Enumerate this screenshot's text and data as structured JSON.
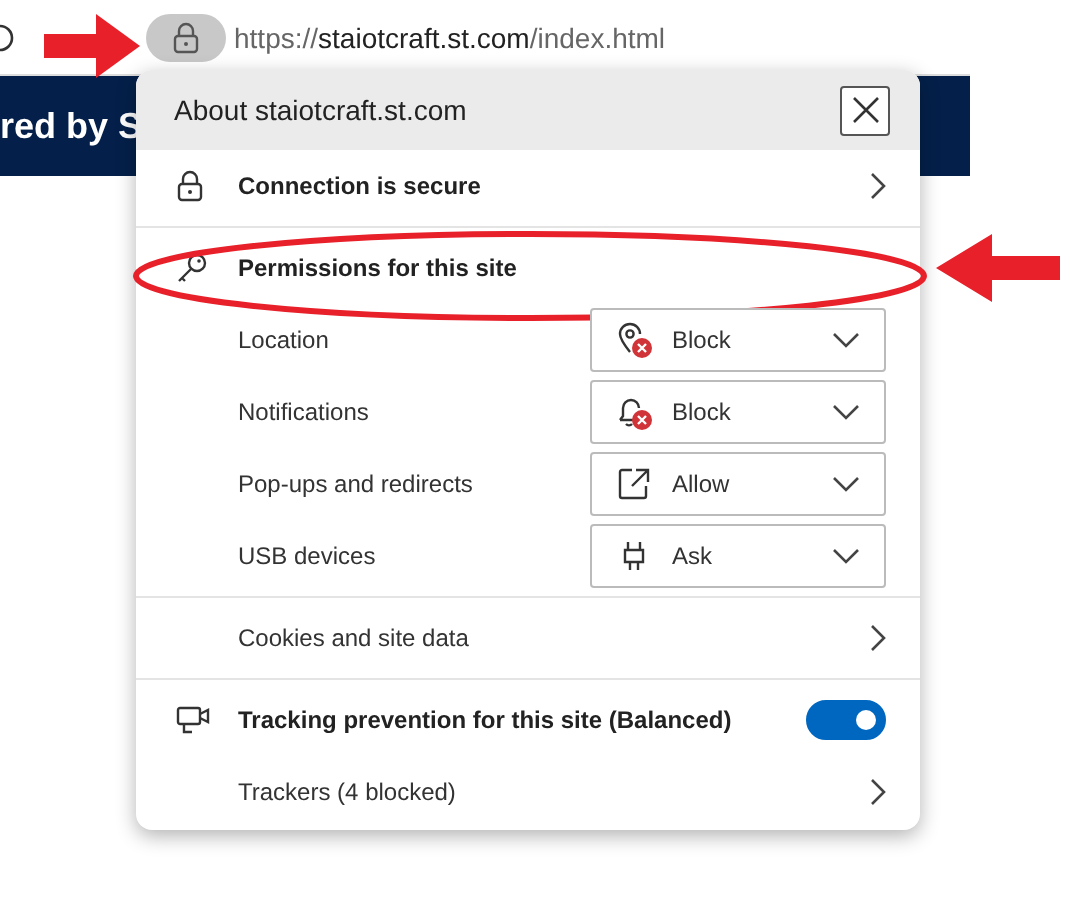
{
  "browser": {
    "url_scheme": "https://",
    "url_host": "staiotcraft.st.com",
    "url_path": "/index.html",
    "lock_highlighted": true
  },
  "page": {
    "banner_text": "red by S"
  },
  "popup": {
    "title": "About staiotcraft.st.com",
    "rows": [
      {
        "kind": "nav",
        "label": "Connection is secure"
      },
      {
        "kind": "heading",
        "label": "Permissions for this site",
        "highlighted": true
      },
      {
        "kind": "permission",
        "label": "Location",
        "value": "Block",
        "blocked": true
      },
      {
        "kind": "permission",
        "label": "Notifications",
        "value": "Block",
        "blocked": true
      },
      {
        "kind": "permission",
        "label": "Pop-ups and redirects",
        "value": "Allow",
        "blocked": false
      },
      {
        "kind": "permission",
        "label": "USB devices",
        "value": "Ask",
        "blocked": false
      },
      {
        "kind": "nav",
        "label": "Cookies and site data"
      },
      {
        "kind": "toggle",
        "label": "Tracking prevention for this site (Balanced)",
        "on": true
      },
      {
        "kind": "nav",
        "label": "Trackers (4 blocked)"
      }
    ]
  }
}
